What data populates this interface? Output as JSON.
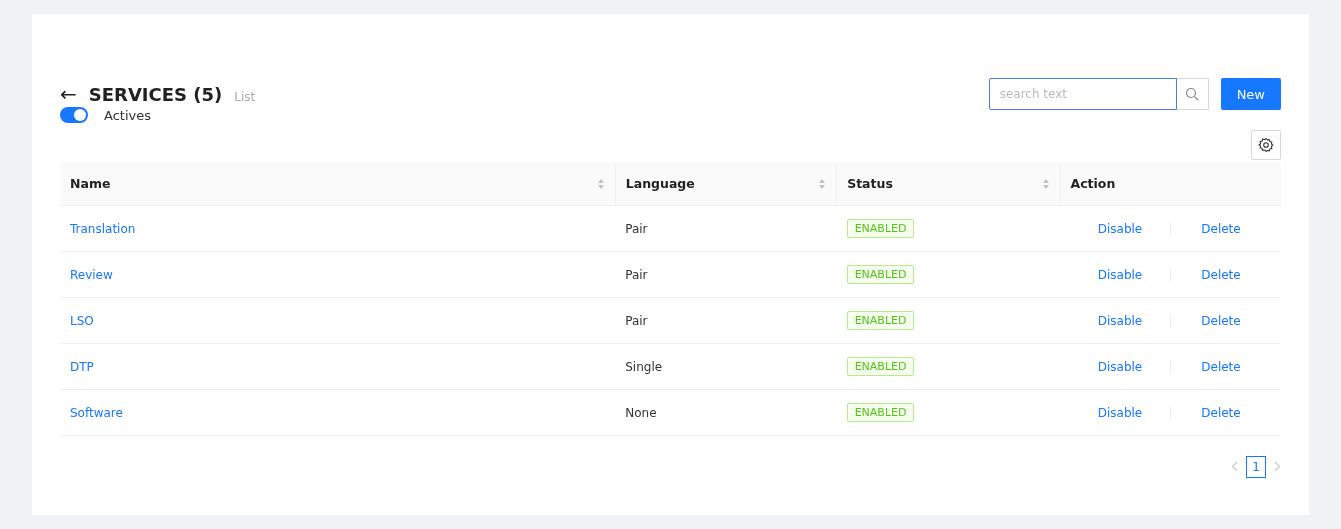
{
  "header": {
    "back": "←",
    "title": "SERVICES (5)",
    "subtitle": "List"
  },
  "search": {
    "placeholder": "search text"
  },
  "new_button": "New",
  "actives_toggle": {
    "label": "Actives",
    "on": true
  },
  "table": {
    "columns": [
      {
        "label": "Name",
        "sortable": true
      },
      {
        "label": "Language",
        "sortable": true
      },
      {
        "label": "Status",
        "sortable": true
      },
      {
        "label": "Action",
        "sortable": false
      }
    ],
    "rows": [
      {
        "name": "Translation",
        "language": "Pair",
        "status": "ENABLED",
        "actions": [
          "Disable",
          "Delete"
        ]
      },
      {
        "name": "Review",
        "language": "Pair",
        "status": "ENABLED",
        "actions": [
          "Disable",
          "Delete"
        ]
      },
      {
        "name": "LSO",
        "language": "Pair",
        "status": "ENABLED",
        "actions": [
          "Disable",
          "Delete"
        ]
      },
      {
        "name": "DTP",
        "language": "Single",
        "status": "ENABLED",
        "actions": [
          "Disable",
          "Delete"
        ]
      },
      {
        "name": "Software",
        "language": "None",
        "status": "ENABLED",
        "actions": [
          "Disable",
          "Delete"
        ]
      }
    ]
  },
  "pagination": {
    "prev_disabled": true,
    "next_disabled": true,
    "pages": [
      {
        "label": "1",
        "selected": true
      }
    ]
  }
}
